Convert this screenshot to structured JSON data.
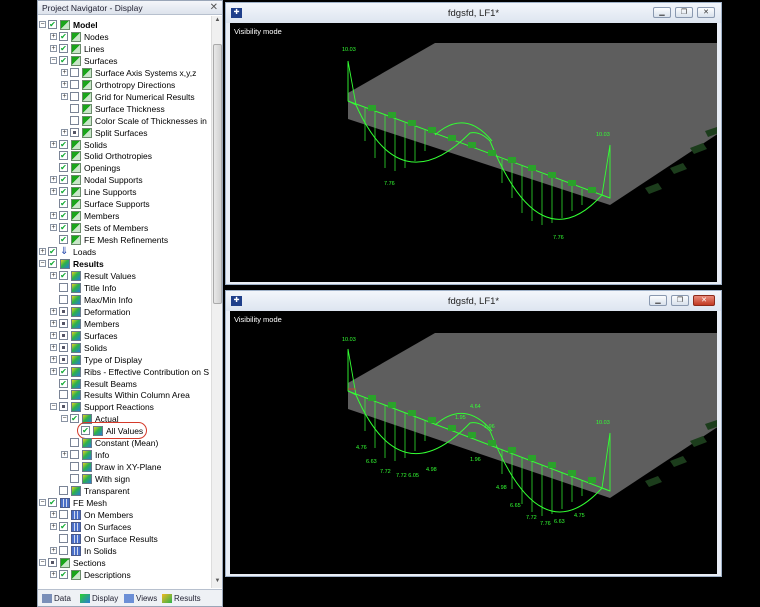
{
  "navigator": {
    "title": "Project Navigator - Display",
    "tree": [
      {
        "label": "Model",
        "level": 0,
        "bold": true,
        "exp": "-",
        "cb": "check",
        "icon": "model"
      },
      {
        "label": "Nodes",
        "level": 1,
        "exp": "+",
        "cb": "check",
        "icon": "model"
      },
      {
        "label": "Lines",
        "level": 1,
        "exp": "+",
        "cb": "check",
        "icon": "model"
      },
      {
        "label": "Surfaces",
        "level": 1,
        "exp": "-",
        "cb": "check",
        "icon": "model"
      },
      {
        "label": "Surface Axis Systems x,y,z",
        "level": 2,
        "exp": "+",
        "cb": "none",
        "icon": "model"
      },
      {
        "label": "Orthotropy Directions",
        "level": 2,
        "exp": "+",
        "cb": "none",
        "icon": "model"
      },
      {
        "label": "Grid for Numerical Results",
        "level": 2,
        "exp": "+",
        "cb": "none",
        "icon": "model"
      },
      {
        "label": "Surface Thickness",
        "level": 2,
        "exp": "",
        "cb": "none",
        "icon": "model"
      },
      {
        "label": "Color Scale of Thicknesses in",
        "level": 2,
        "exp": "",
        "cb": "none",
        "icon": "model"
      },
      {
        "label": "Split Surfaces",
        "level": 2,
        "exp": "+",
        "cb": "part",
        "icon": "model"
      },
      {
        "label": "Solids",
        "level": 1,
        "exp": "+",
        "cb": "check",
        "icon": "model"
      },
      {
        "label": "Solid Orthotropies",
        "level": 1,
        "exp": "",
        "cb": "check",
        "icon": "model"
      },
      {
        "label": "Openings",
        "level": 1,
        "exp": "",
        "cb": "check",
        "icon": "model"
      },
      {
        "label": "Nodal Supports",
        "level": 1,
        "exp": "+",
        "cb": "check",
        "icon": "model"
      },
      {
        "label": "Line Supports",
        "level": 1,
        "exp": "+",
        "cb": "check",
        "icon": "model"
      },
      {
        "label": "Surface Supports",
        "level": 1,
        "exp": "",
        "cb": "check",
        "icon": "model"
      },
      {
        "label": "Members",
        "level": 1,
        "exp": "+",
        "cb": "check",
        "icon": "model"
      },
      {
        "label": "Sets of Members",
        "level": 1,
        "exp": "+",
        "cb": "check",
        "icon": "model"
      },
      {
        "label": "FE Mesh Refinements",
        "level": 1,
        "exp": "",
        "cb": "check",
        "icon": "model"
      },
      {
        "label": "Loads",
        "level": 0,
        "exp": "+",
        "cb": "check",
        "icon": "loads"
      },
      {
        "label": "Results",
        "level": 0,
        "bold": true,
        "exp": "-",
        "cb": "check",
        "icon": "results"
      },
      {
        "label": "Result Values",
        "level": 1,
        "exp": "+",
        "cb": "check",
        "icon": "results"
      },
      {
        "label": "Title Info",
        "level": 1,
        "exp": "",
        "cb": "none",
        "icon": "results"
      },
      {
        "label": "Max/Min Info",
        "level": 1,
        "exp": "",
        "cb": "none",
        "icon": "results"
      },
      {
        "label": "Deformation",
        "level": 1,
        "exp": "+",
        "cb": "part",
        "icon": "results"
      },
      {
        "label": "Members",
        "level": 1,
        "exp": "+",
        "cb": "part",
        "icon": "results"
      },
      {
        "label": "Surfaces",
        "level": 1,
        "exp": "+",
        "cb": "part",
        "icon": "results"
      },
      {
        "label": "Solids",
        "level": 1,
        "exp": "+",
        "cb": "part",
        "icon": "results"
      },
      {
        "label": "Type of Display",
        "level": 1,
        "exp": "+",
        "cb": "part",
        "icon": "results"
      },
      {
        "label": "Ribs - Effective Contribution on S",
        "level": 1,
        "exp": "+",
        "cb": "check",
        "icon": "results"
      },
      {
        "label": "Result Beams",
        "level": 1,
        "exp": "",
        "cb": "check",
        "icon": "results"
      },
      {
        "label": "Results Within Column Area",
        "level": 1,
        "exp": "",
        "cb": "none",
        "icon": "results"
      },
      {
        "label": "Support Reactions",
        "level": 1,
        "exp": "-",
        "cb": "part",
        "icon": "results"
      },
      {
        "label": "Actual",
        "level": 2,
        "exp": "-",
        "cb": "check",
        "icon": "results"
      },
      {
        "label": "All Values",
        "level": 3,
        "exp": "",
        "cb": "check",
        "icon": "results",
        "highlight": true
      },
      {
        "label": "Constant (Mean)",
        "level": 2,
        "exp": "",
        "cb": "none",
        "icon": "results"
      },
      {
        "label": "Info",
        "level": 2,
        "exp": "+",
        "cb": "none",
        "icon": "results"
      },
      {
        "label": "Draw in XY-Plane",
        "level": 2,
        "exp": "",
        "cb": "none",
        "icon": "results"
      },
      {
        "label": "With sign",
        "level": 2,
        "exp": "",
        "cb": "none",
        "icon": "results"
      },
      {
        "label": "Transparent",
        "level": 1,
        "exp": "",
        "cb": "none",
        "icon": "results"
      },
      {
        "label": "FE Mesh",
        "level": 0,
        "exp": "-",
        "cb": "check",
        "icon": "mesh"
      },
      {
        "label": "On Members",
        "level": 1,
        "exp": "+",
        "cb": "none",
        "icon": "mesh"
      },
      {
        "label": "On Surfaces",
        "level": 1,
        "exp": "+",
        "cb": "check",
        "icon": "mesh"
      },
      {
        "label": "On Surface Results",
        "level": 1,
        "exp": "",
        "cb": "none",
        "icon": "mesh"
      },
      {
        "label": "In Solids",
        "level": 1,
        "exp": "+",
        "cb": "none",
        "icon": "mesh"
      },
      {
        "label": "Sections",
        "level": 0,
        "exp": "-",
        "cb": "part",
        "icon": "model"
      },
      {
        "label": "Descriptions",
        "level": 1,
        "exp": "+",
        "cb": "check",
        "icon": "model"
      }
    ],
    "tabs": [
      "Data",
      "Display",
      "Views",
      "Results"
    ]
  },
  "windows": [
    {
      "title": "fdgsfd, LF1*",
      "vis_mode": "Visibility mode",
      "labels": [
        "10.03",
        "10.03",
        "7.76",
        "7.76"
      ]
    },
    {
      "title": "fdgsfd, LF1*",
      "vis_mode": "Visibility mode",
      "labels": [
        "10.03",
        "10.03",
        "4.64",
        "1.95",
        "1.96",
        "4.76",
        "6.63",
        "7.72",
        "7.72 6.05",
        "4.98",
        "1.96",
        "4.98",
        "6.65",
        "7.72",
        "7.76",
        "6.63",
        "4.75"
      ]
    }
  ],
  "colors": {
    "diagram": "#33ff33",
    "slab": "#5e5e5e",
    "highlight_ring": "#d43a2a",
    "accent_close": "#c23a22"
  }
}
